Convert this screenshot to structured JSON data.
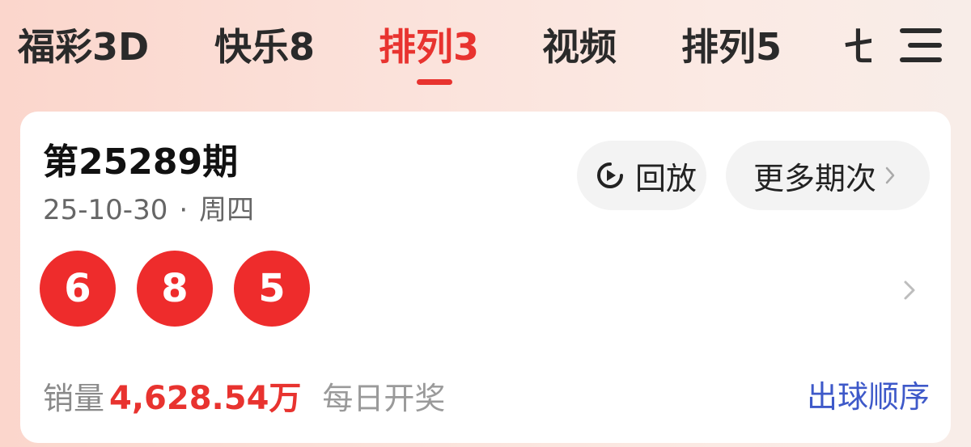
{
  "tabs": [
    {
      "label": "福彩3D",
      "active": false
    },
    {
      "label": "快乐8",
      "active": false
    },
    {
      "label": "排列3",
      "active": true
    },
    {
      "label": "视频",
      "active": false
    },
    {
      "label": "排列5",
      "active": false
    },
    {
      "label": "七",
      "active": false
    }
  ],
  "card": {
    "issue": "第25289期",
    "date": "25-10-30",
    "separator": "·",
    "weekday": "周四",
    "replay_label": "回放",
    "more_label": "更多期次",
    "balls": [
      "6",
      "8",
      "5"
    ],
    "sales_label": "销量",
    "sales_value": "4,628.54万",
    "frequency": "每日开奖",
    "order_link": "出球顺序"
  },
  "colors": {
    "accent": "#e8332f",
    "ball": "#ee2c2c",
    "link": "#3e59c9"
  },
  "icons": {
    "menu": "menu-icon",
    "replay": "replay-icon",
    "chevron": "chevron-right-icon"
  }
}
